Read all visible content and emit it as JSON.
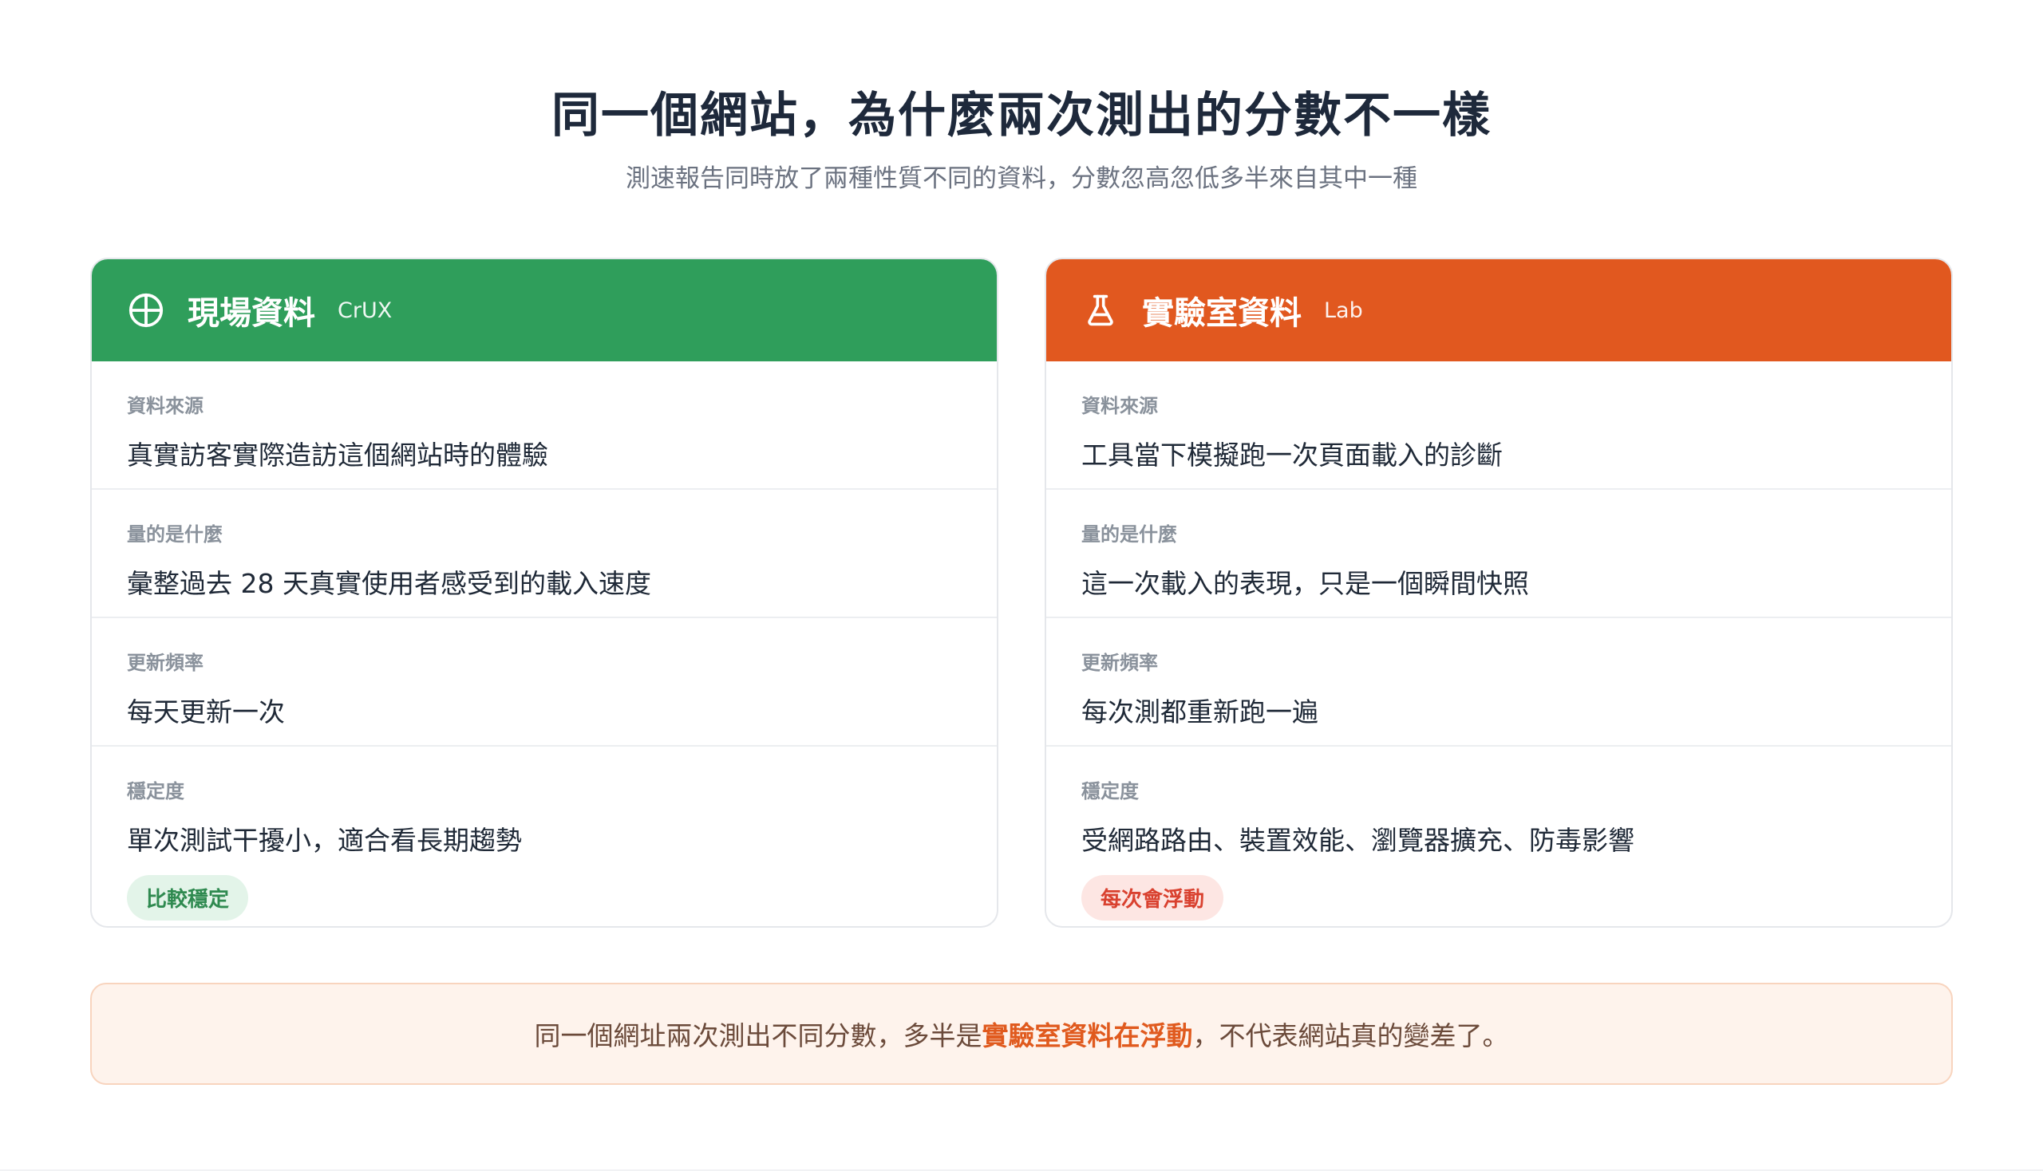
{
  "header": {
    "title": "同一個網站，為什麼兩次測出的分數不一樣",
    "subtitle": "測速報告同時放了兩種性質不同的資料，分數忽高忽低多半來自其中一種"
  },
  "cards": {
    "field": {
      "icon": "globe-icon",
      "name": "現場資料",
      "tag": "CrUX",
      "color": "#2f9e5b",
      "rows": [
        {
          "label": "資料來源",
          "value": "真實訪客實際造訪這個網站時的體驗"
        },
        {
          "label": "量的是什麼",
          "value": "彙整過去 28 天真實使用者感受到的載入速度"
        },
        {
          "label": "更新頻率",
          "value": "每天更新一次"
        },
        {
          "label": "穩定度",
          "value": "單次測試干擾小，適合看長期趨勢",
          "badge": "比較穩定"
        }
      ]
    },
    "lab": {
      "icon": "flask-icon",
      "name": "實驗室資料",
      "tag": "Lab",
      "color": "#e1581f",
      "rows": [
        {
          "label": "資料來源",
          "value": "工具當下模擬跑一次頁面載入的診斷"
        },
        {
          "label": "量的是什麼",
          "value": "這一次載入的表現，只是一個瞬間快照"
        },
        {
          "label": "更新頻率",
          "value": "每次測都重新跑一遍"
        },
        {
          "label": "穩定度",
          "value": "受網路路由、裝置效能、瀏覽器擴充、防毒影響",
          "badge": "每次會浮動"
        }
      ]
    }
  },
  "note": {
    "before": "同一個網址兩次測出不同分數，多半是",
    "highlight": "實驗室資料在浮動",
    "after": "，不代表網站真的變差了。"
  }
}
